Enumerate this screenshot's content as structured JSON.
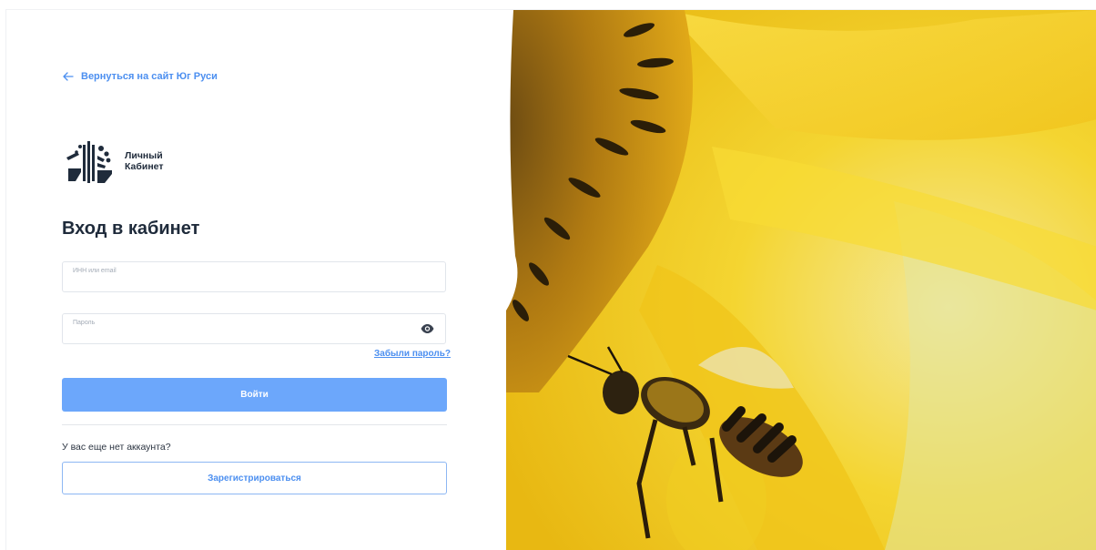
{
  "nav": {
    "back_label": "Вернуться на сайт Юг Руси"
  },
  "logo": {
    "line1": "Личный",
    "line2": "Кабинет"
  },
  "form": {
    "title": "Вход в кабинет",
    "login_label": "ИНН или email",
    "login_value": "",
    "password_label": "Пароль",
    "password_value": "",
    "forgot_label": "Забыли пароль?",
    "submit_label": "Войти",
    "no_account_text": "У вас еще нет аккаунта?",
    "register_label": "Зарегистрироваться"
  },
  "colors": {
    "accent": "#4c8ff0",
    "button": "#6ca7fb",
    "title": "#1f2b3b",
    "hero_yellow": "#f6d21f"
  },
  "icons": [
    "arrow-left-icon",
    "logo-emblem-icon",
    "eye-icon"
  ],
  "hero": {
    "image": "sunflower-and-bee"
  }
}
